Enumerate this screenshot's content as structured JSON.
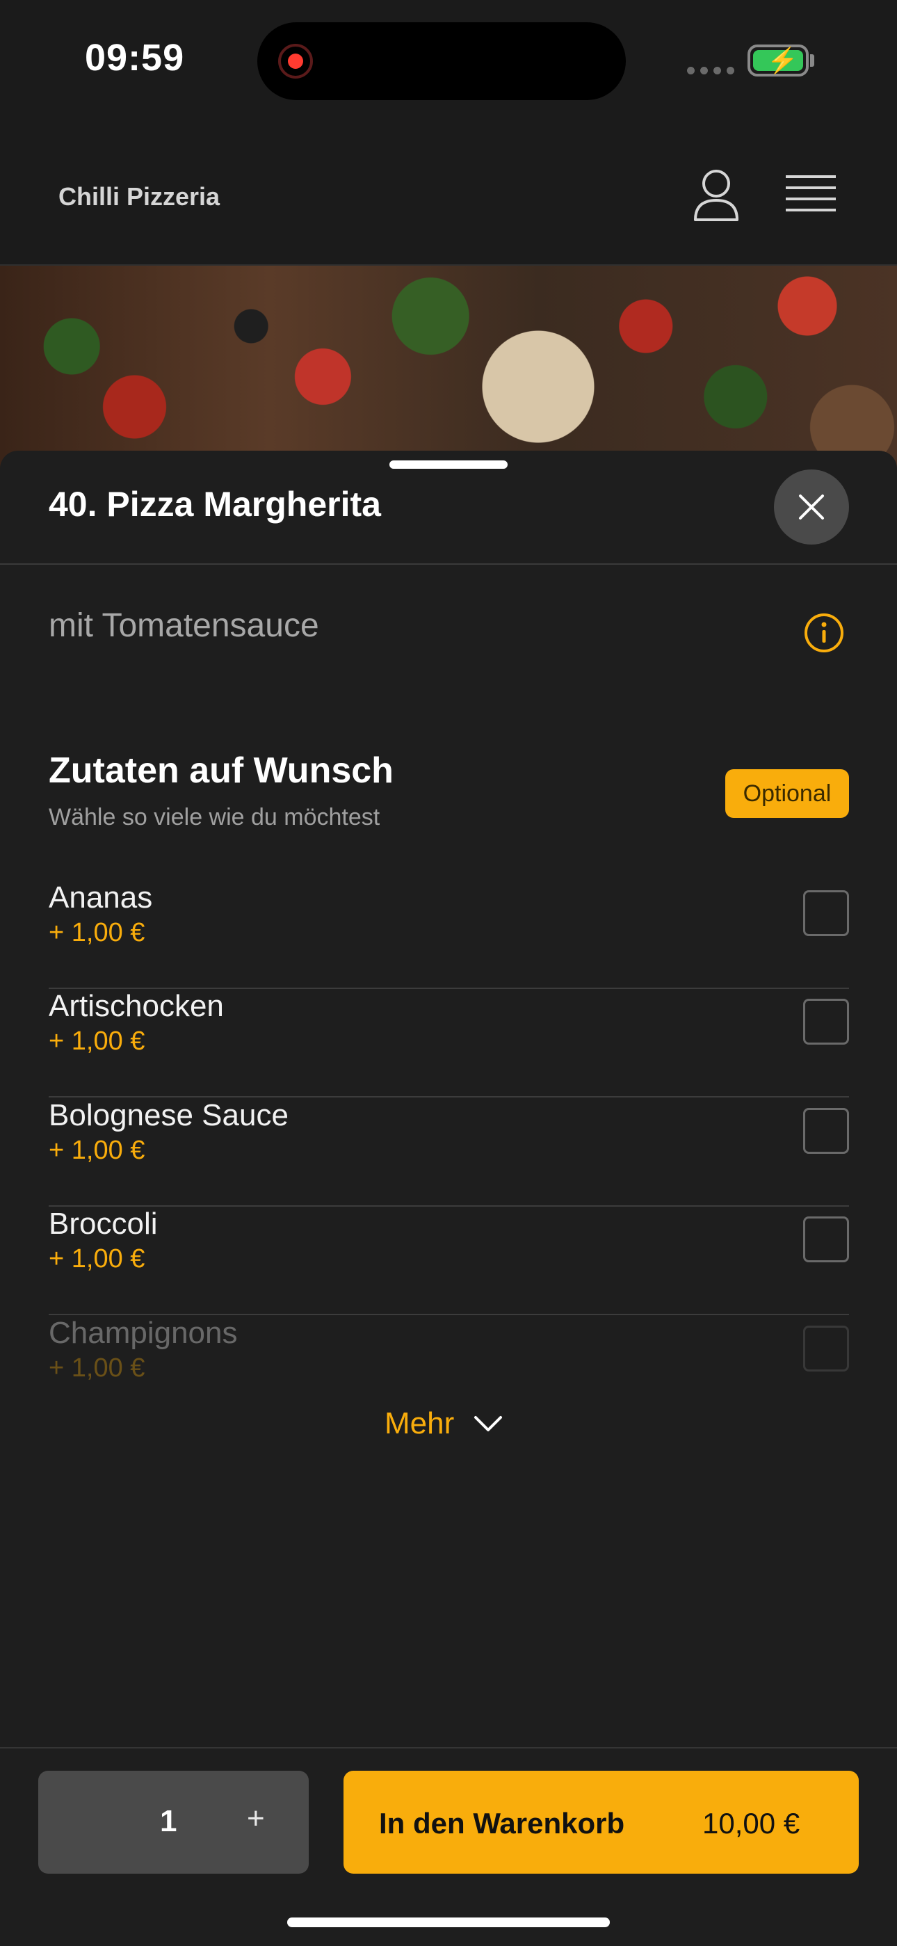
{
  "status_bar": {
    "time": "09:59"
  },
  "header": {
    "brand": "Chilli Pizzeria"
  },
  "product": {
    "title": "40. Pizza Margherita",
    "description": "mit Tomatensauce"
  },
  "extras": {
    "title": "Zutaten auf Wunsch",
    "subtitle": "Wähle so viele wie du möchtest",
    "badge": "Optional",
    "items": [
      {
        "name": "Ananas",
        "price": "+ 1,00 €"
      },
      {
        "name": "Artischocken",
        "price": "+ 1,00 €"
      },
      {
        "name": "Bolognese Sauce",
        "price": "+ 1,00 €"
      },
      {
        "name": "Broccoli",
        "price": "+ 1,00 €"
      },
      {
        "name": "Champignons",
        "price": "+ 1,00 €"
      }
    ],
    "more_label": "Mehr"
  },
  "footer": {
    "quantity": "1",
    "plus_label": "+",
    "cart_label": "In den Warenkorb",
    "cart_price": "10,00 €"
  },
  "colors": {
    "accent": "#f9ad0c",
    "background": "#1e1e1e",
    "battery": "#34c759"
  },
  "icons": [
    "record-indicator-icon",
    "battery-charging-icon",
    "user-icon",
    "menu-icon",
    "close-icon",
    "info-icon",
    "chevron-down-icon"
  ]
}
